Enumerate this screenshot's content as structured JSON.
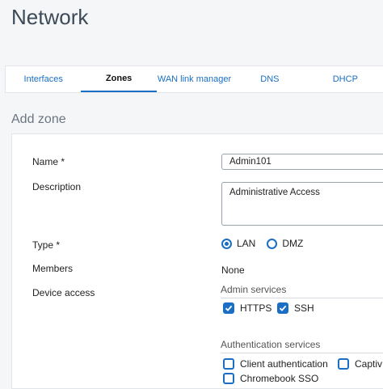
{
  "page": {
    "title": "Network"
  },
  "tabs": [
    {
      "label": "Interfaces"
    },
    {
      "label": "Zones"
    },
    {
      "label": "WAN link manager"
    },
    {
      "label": "DNS"
    },
    {
      "label": "DHCP"
    }
  ],
  "active_tab": "Zones",
  "section": {
    "title": "Add zone"
  },
  "form": {
    "name_label": "Name *",
    "name_value": "Admin101",
    "description_label": "Description",
    "description_value": "Administrative Access",
    "type_label": "Type *",
    "type_options": [
      "LAN",
      "DMZ"
    ],
    "type_selected": "LAN",
    "members_label": "Members",
    "members_value": "None",
    "device_access_label": "Device access",
    "admin_services_heading": "Admin services",
    "admin_services": [
      {
        "label": "HTTPS",
        "checked": true
      },
      {
        "label": "SSH",
        "checked": true
      }
    ],
    "auth_services_heading": "Authentication services",
    "auth_services": [
      {
        "label": "Client authentication",
        "checked": false
      },
      {
        "label": "Captiv",
        "checked": false
      },
      {
        "label": "Chromebook SSO",
        "checked": false
      }
    ]
  },
  "colors": {
    "accent": "#1a6fc4",
    "title": "#3c4a57",
    "background": "#f5f6f8"
  }
}
